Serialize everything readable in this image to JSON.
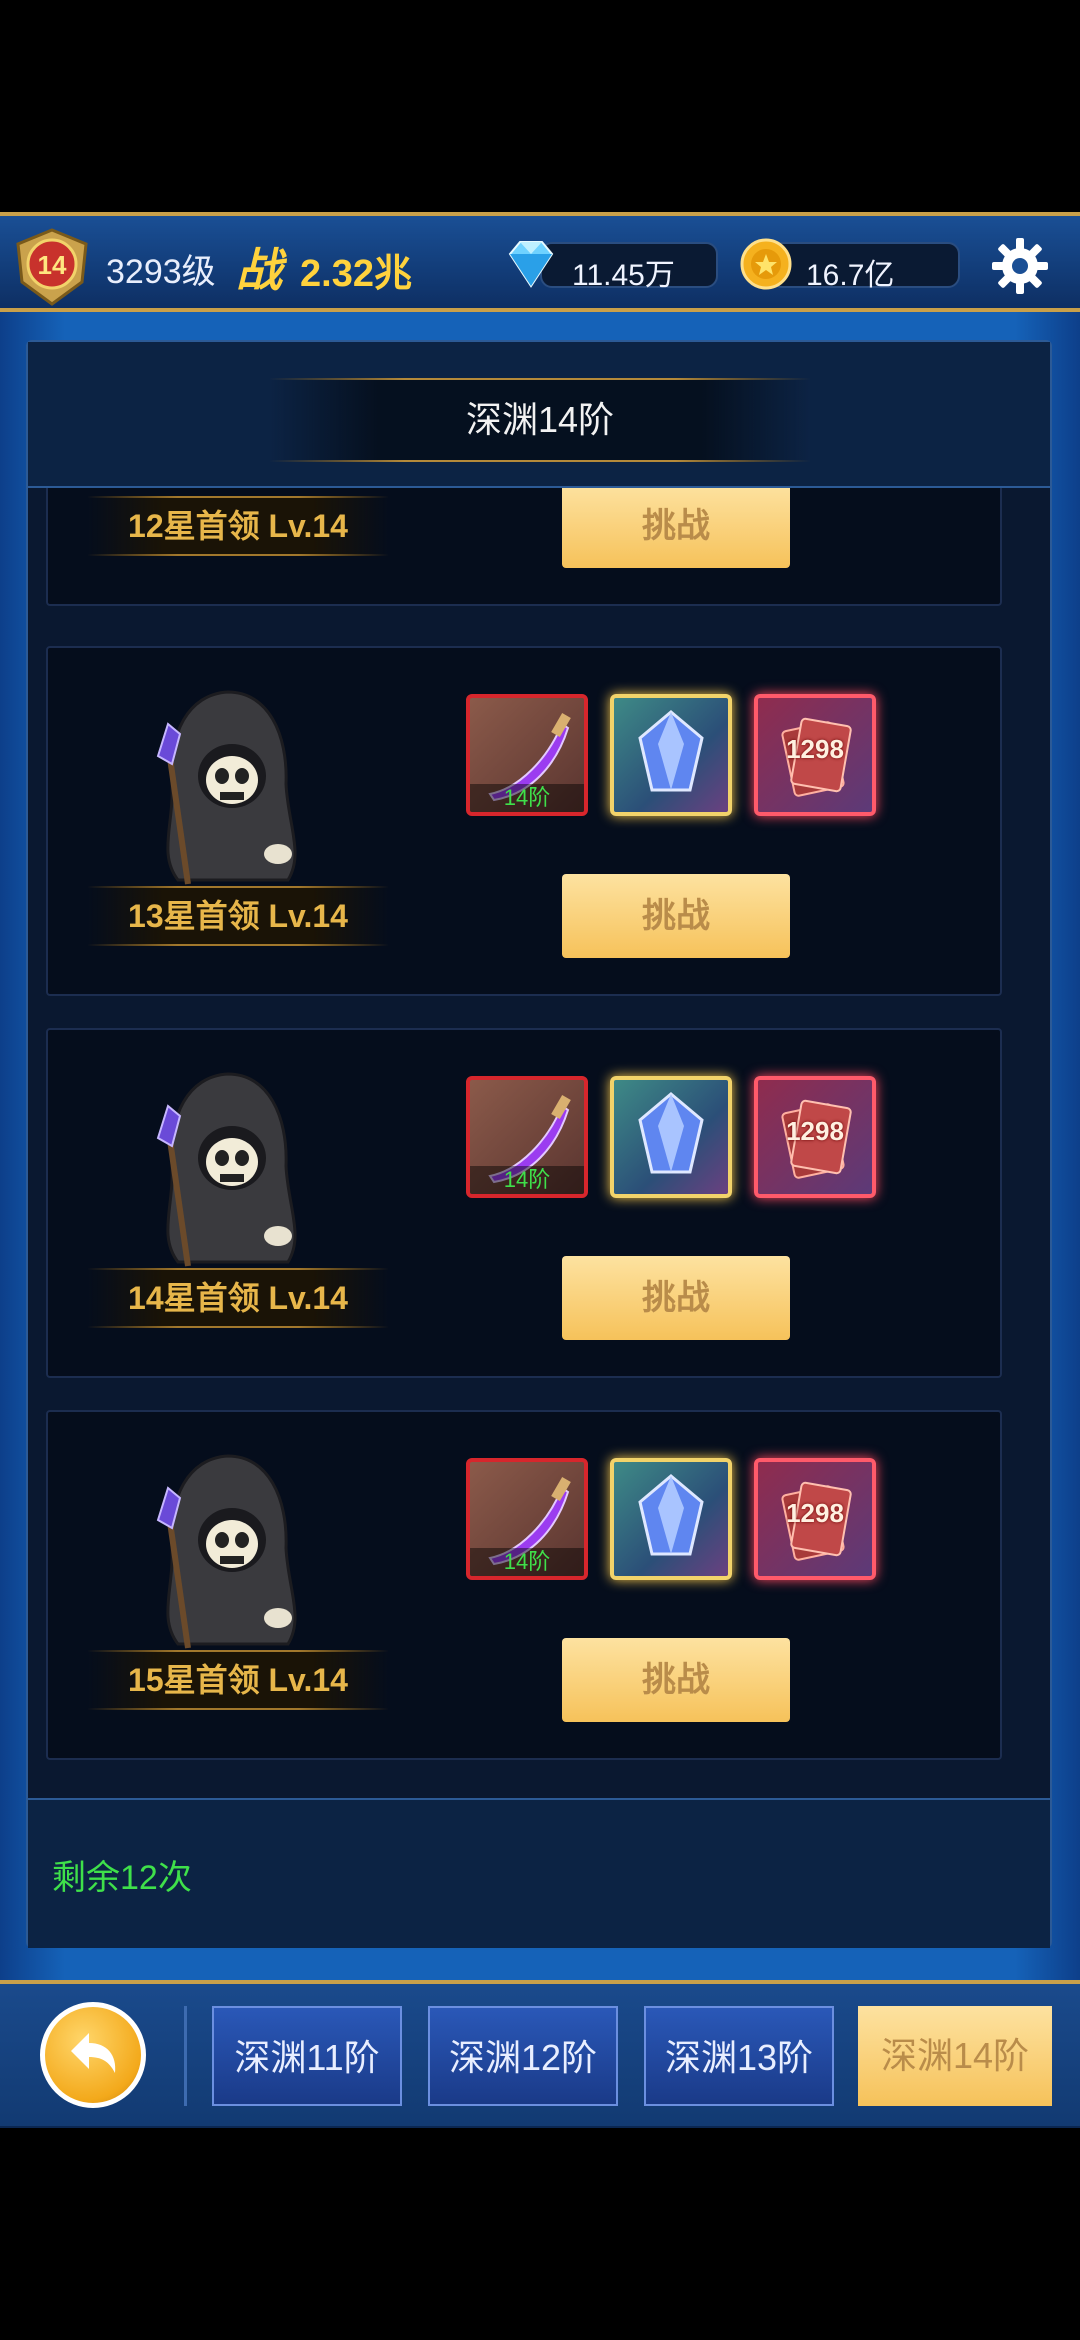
{
  "header": {
    "avatar_level": "14",
    "player_level": "3293级",
    "power_label": "战",
    "power_value": "2.32兆",
    "diamonds": "11.45万",
    "gold": "16.7亿"
  },
  "panel": {
    "title": "深渊14阶",
    "remaining": "剩余12次"
  },
  "bosses": [
    {
      "name": "12星首领 Lv.14",
      "button": "挑战"
    },
    {
      "name": "13星首领 Lv.14",
      "button": "挑战",
      "rewards": [
        {
          "type": "weapon",
          "label": "14阶"
        },
        {
          "type": "crystal"
        },
        {
          "type": "cards",
          "label": "1298"
        }
      ]
    },
    {
      "name": "14星首领 Lv.14",
      "button": "挑战",
      "rewards": [
        {
          "type": "weapon",
          "label": "14阶"
        },
        {
          "type": "crystal"
        },
        {
          "type": "cards",
          "label": "1298"
        }
      ]
    },
    {
      "name": "15星首领 Lv.14",
      "button": "挑战",
      "rewards": [
        {
          "type": "weapon",
          "label": "14阶"
        },
        {
          "type": "crystal"
        },
        {
          "type": "cards",
          "label": "1298"
        }
      ]
    }
  ],
  "tabs": [
    {
      "label": "深渊11阶",
      "active": false
    },
    {
      "label": "深渊12阶",
      "active": false
    },
    {
      "label": "深渊13阶",
      "active": false
    },
    {
      "label": "深渊14阶",
      "active": true
    }
  ],
  "icons": {
    "level_badge": "laurel-badge-icon",
    "diamond": "diamond-icon",
    "gold": "gold-coin-icon",
    "settings": "gear-icon",
    "back": "back-arrow-icon",
    "boss": "grim-reaper-icon"
  },
  "colors": {
    "accent_gold": "#c9a04a",
    "button_bg": "#f6c25a",
    "remaining_text": "#3fe04a",
    "power_text": "#ffd23d"
  }
}
